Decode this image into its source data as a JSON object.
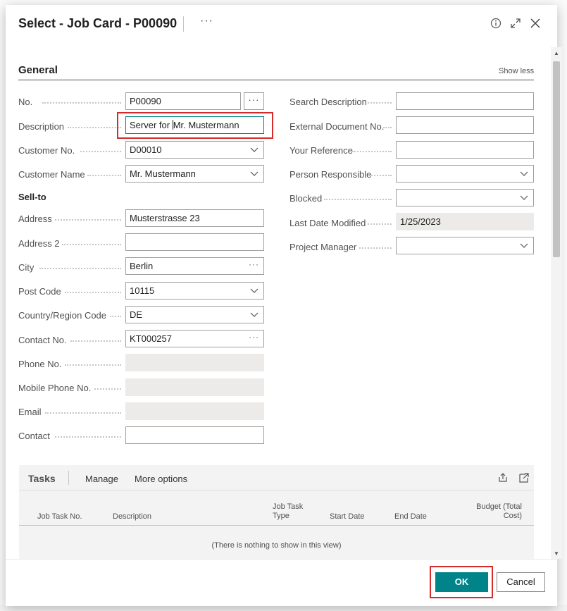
{
  "dialog": {
    "title": "Select - Job Card - P00090",
    "more_label": "···"
  },
  "general": {
    "title": "General",
    "show_less": "Show less",
    "sell_to_heading": "Sell-to"
  },
  "left_fields": [
    {
      "label": "No.",
      "value": "P00090"
    },
    {
      "label": "Description",
      "value_before_caret": "Server for ",
      "value_after_caret": "Mr. Mustermann"
    },
    {
      "label": "Customer No.",
      "value": "D00010"
    },
    {
      "label": "Customer Name",
      "value": "Mr. Mustermann"
    },
    {
      "label": "Address",
      "value": "Musterstrasse 23"
    },
    {
      "label": "Address 2",
      "value": ""
    },
    {
      "label": "City",
      "value": "Berlin"
    },
    {
      "label": "Post Code",
      "value": "10115"
    },
    {
      "label": "Country/Region Code",
      "value": "DE"
    },
    {
      "label": "Contact No.",
      "value": "KT000257"
    },
    {
      "label": "Phone No.",
      "value": ""
    },
    {
      "label": "Mobile Phone No.",
      "value": ""
    },
    {
      "label": "Email",
      "value": ""
    },
    {
      "label": "Contact",
      "value": ""
    }
  ],
  "right_fields": [
    {
      "label": "Search Description",
      "value": ""
    },
    {
      "label": "External Document No.",
      "value": ""
    },
    {
      "label": "Your Reference",
      "value": ""
    },
    {
      "label": "Person Responsible",
      "value": ""
    },
    {
      "label": "Blocked",
      "value": ""
    },
    {
      "label": "Last Date Modified",
      "value": "1/25/2023"
    },
    {
      "label": "Project Manager",
      "value": ""
    }
  ],
  "tasks": {
    "title": "Tasks",
    "actions": [
      "Manage",
      "More options"
    ],
    "columns": [
      "Job Task No.",
      "Description",
      "Job Task Type",
      "Start Date",
      "End Date",
      "Budget (Total Cost)"
    ],
    "empty_message": "(There is nothing to show in this view)"
  },
  "footer": {
    "ok_label": "OK",
    "cancel_label": "Cancel"
  },
  "colors": {
    "accent": "#008489",
    "highlight": "#d52b2b"
  }
}
